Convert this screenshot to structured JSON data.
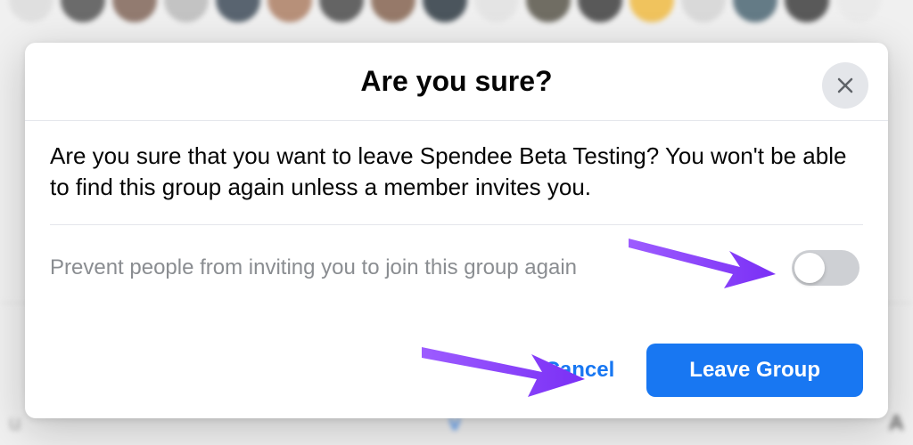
{
  "modal": {
    "title": "Are you sure?",
    "body": "Are you sure that you want to leave Spendee Beta Testing? You won't be able to find this group again unless a member invites you.",
    "toggle_label": "Prevent people from inviting you to join this group again",
    "cancel_label": "Cancel",
    "primary_label": "Leave Group"
  },
  "colors": {
    "primary": "#1877f2",
    "arrow": "#8a3ffc"
  }
}
